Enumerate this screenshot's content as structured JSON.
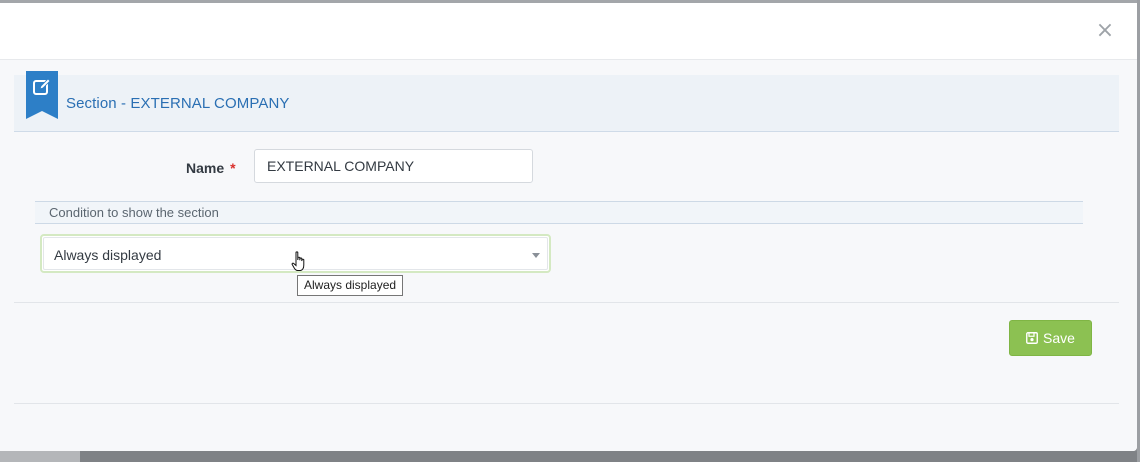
{
  "modal": {
    "close_symbol": "×",
    "section": {
      "title": "Section - EXTERNAL COMPANY",
      "icon": "edit-icon",
      "accent_color": "#2d7fc7"
    },
    "form": {
      "name_label": "Name",
      "required_marker": "*",
      "name_value": "EXTERNAL COMPANY",
      "condition_header": "Condition to show the section",
      "condition_selected": "Always displayed",
      "tooltip": "Always displayed"
    },
    "footer": {
      "save_label": "Save",
      "save_icon": "floppy-disk-icon",
      "save_color": "#8cc152"
    }
  }
}
